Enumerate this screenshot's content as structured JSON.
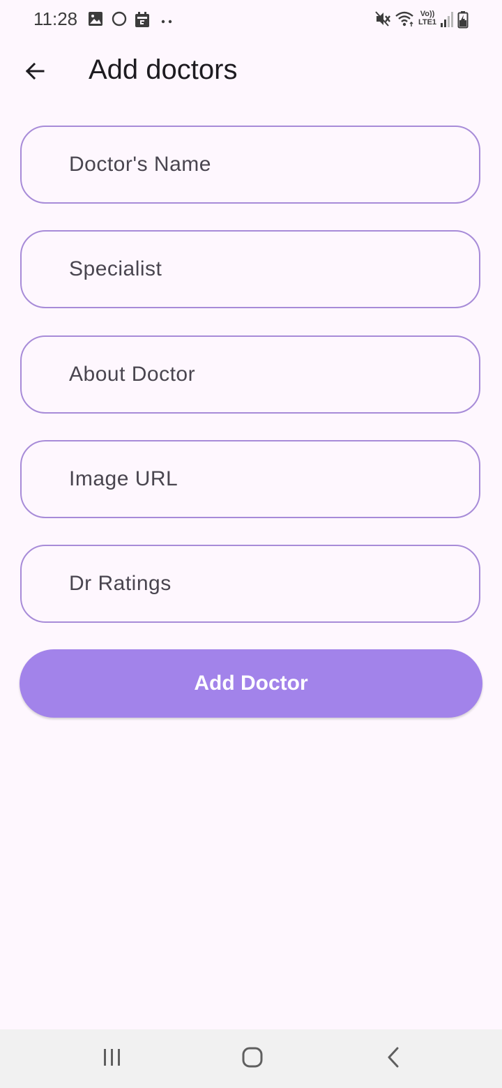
{
  "status_bar": {
    "time": "11:28",
    "left_icons": [
      "gallery-icon",
      "circle-icon",
      "calendar-icon",
      "more-dots-icon"
    ],
    "right_icons": [
      "mute-icon",
      "wifi-icon",
      "volte-lte-icon",
      "signal-icon",
      "battery-icon"
    ],
    "volte_label": "Vo))",
    "lte_label": "LTE1"
  },
  "app_bar": {
    "title": "Add doctors",
    "back_icon": "arrow-back-icon"
  },
  "form": {
    "fields": [
      {
        "placeholder": "Doctor's Name",
        "value": ""
      },
      {
        "placeholder": "Specialist",
        "value": ""
      },
      {
        "placeholder": "About Doctor",
        "value": ""
      },
      {
        "placeholder": "Image URL",
        "value": ""
      },
      {
        "placeholder": "Dr Ratings",
        "value": ""
      }
    ],
    "submit_label": "Add Doctor"
  },
  "nav_bar": {
    "icons": [
      "recent-apps-icon",
      "home-icon",
      "back-nav-icon"
    ]
  },
  "colors": {
    "background": "#fef7fe",
    "field_border": "#a78bd8",
    "button_bg": "#a283ea",
    "button_text": "#ffffff",
    "nav_bar_bg": "#f1f1f1"
  }
}
